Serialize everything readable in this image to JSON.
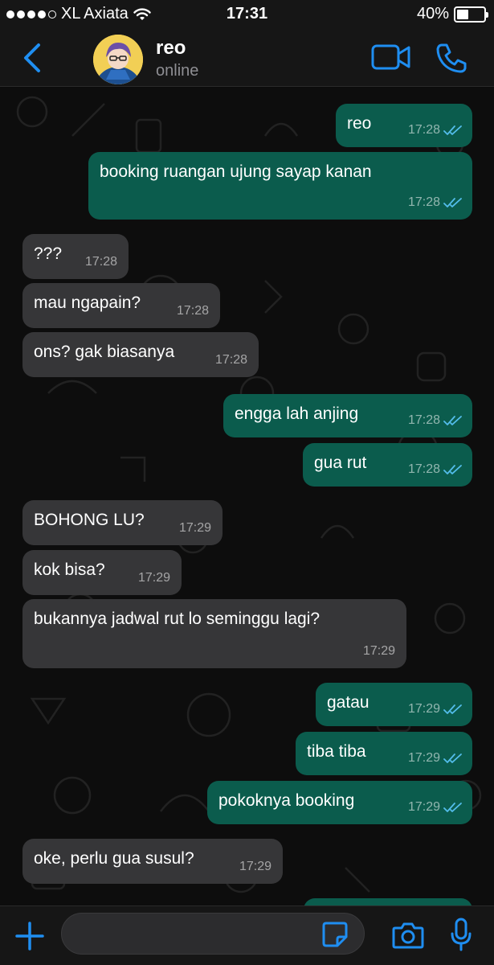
{
  "status_bar": {
    "carrier": "XL Axiata",
    "time": "17:31",
    "battery": "40%",
    "battery_level": 0.4
  },
  "header": {
    "contact_name": "reo",
    "contact_status": "online"
  },
  "messages": [
    {
      "dir": "out",
      "text": "reo",
      "time": "17:28"
    },
    {
      "dir": "out",
      "text": "booking ruangan ujung sayap kanan",
      "time": "17:28"
    },
    {
      "dir": "in",
      "text": "???",
      "time": "17:28"
    },
    {
      "dir": "in",
      "text": "mau ngapain?",
      "time": "17:28"
    },
    {
      "dir": "in",
      "text": "ons? gak biasanya",
      "time": "17:28"
    },
    {
      "dir": "out",
      "text": "engga lah anjing",
      "time": "17:28"
    },
    {
      "dir": "out",
      "text": "gua rut",
      "time": "17:28"
    },
    {
      "dir": "in",
      "text": "BOHONG LU?",
      "time": "17:29"
    },
    {
      "dir": "in",
      "text": "kok bisa?",
      "time": "17:29"
    },
    {
      "dir": "in",
      "text": "bukannya jadwal rut lo seminggu lagi?",
      "time": "17:29"
    },
    {
      "dir": "out",
      "text": "gatau",
      "time": "17:29"
    },
    {
      "dir": "out",
      "text": "tiba tiba",
      "time": "17:29"
    },
    {
      "dir": "out",
      "text": "pokoknya booking",
      "time": "17:29"
    },
    {
      "dir": "in",
      "text": "oke, perlu gua susul?",
      "time": "17:29"
    }
  ],
  "colors": {
    "accent": "#1f8ef1",
    "outgoing_bubble": "#0b5c4d",
    "incoming_bubble": "#363638",
    "read_ticks": "#53bdeb"
  },
  "icons": {
    "back": "chevron-left-icon",
    "video": "video-camera-icon",
    "call": "phone-icon",
    "attach": "plus-icon",
    "sticker": "sticker-icon",
    "camera": "camera-icon",
    "mic": "microphone-icon"
  }
}
